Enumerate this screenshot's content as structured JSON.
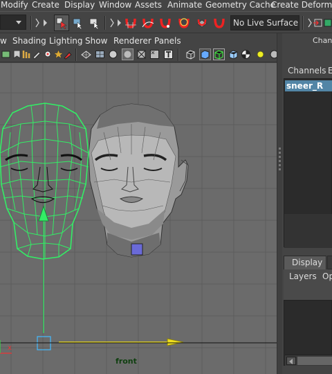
{
  "menubar": {
    "items": [
      "Modify",
      "Create",
      "Display",
      "Window",
      "Assets",
      "Animate",
      "Geometry Cache",
      "Create Deformers"
    ]
  },
  "statusline": {
    "live_surface": "No Live Surface"
  },
  "panel": {
    "menu": [
      "w",
      "Shading",
      "Lighting",
      "Show",
      "Renderer",
      "Panels"
    ],
    "view_label": "front",
    "axis_label": "x"
  },
  "channel_box": {
    "title": "Channe",
    "tabs": [
      "Channels",
      "E"
    ],
    "node_name": "sneer_R"
  },
  "layer_editor": {
    "tabs": [
      "Display"
    ],
    "menu": [
      "Layers",
      "Op"
    ]
  },
  "colors": {
    "wireframe": "#33ee66",
    "selection": "#5285a6",
    "viewport_bg": "#6b6b6b",
    "manipulator_yellow": "#f0e020"
  }
}
